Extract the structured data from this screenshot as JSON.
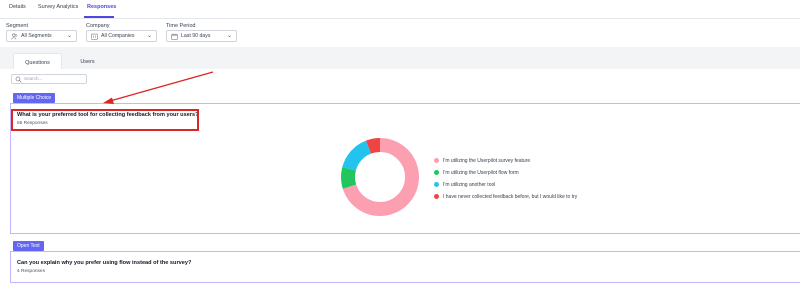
{
  "top_tabs": [
    {
      "label": "Details"
    },
    {
      "label": "Survey Analytics"
    },
    {
      "label": "Responses"
    }
  ],
  "filters": {
    "segment": {
      "label": "Segment",
      "value": "All Segments",
      "icon": "users-icon"
    },
    "company": {
      "label": "Company",
      "value": "All Companies",
      "icon": "building-icon"
    },
    "time_period": {
      "label": "Time Period",
      "value": "Last 90 days",
      "icon": "calendar-icon"
    }
  },
  "sub_tabs": [
    {
      "label": "Questions"
    },
    {
      "label": "Users"
    }
  ],
  "search": {
    "placeholder": "Search..."
  },
  "questions": [
    {
      "type_badge": "Multiple Choice",
      "text": "What is your preferred tool for collecting feedback from your users?",
      "responses": "55 Responses"
    },
    {
      "type_badge": "Open Text",
      "text": "Can you explain why you prefer using flow instead of the survey?",
      "responses": "4 Responses"
    }
  ],
  "chart_data": {
    "type": "pie",
    "title": "",
    "series": [
      {
        "name": "I'm utilizing the Userpilot survey feature",
        "color": "#fb9fb1",
        "value": 70
      },
      {
        "name": "I'm utilizing the Userpilot flow form",
        "color": "#22c55e",
        "value": 9
      },
      {
        "name": "I'm utilizing another tool",
        "color": "#22c4ee",
        "value": 15
      },
      {
        "name": "I have never collected feedback before, but I would like to try",
        "color": "#ef4444",
        "value": 6
      }
    ],
    "legend_position": "right"
  },
  "colors": {
    "accent": "#4f46e5",
    "badge": "#6366f1",
    "highlight": "#dc2626"
  }
}
